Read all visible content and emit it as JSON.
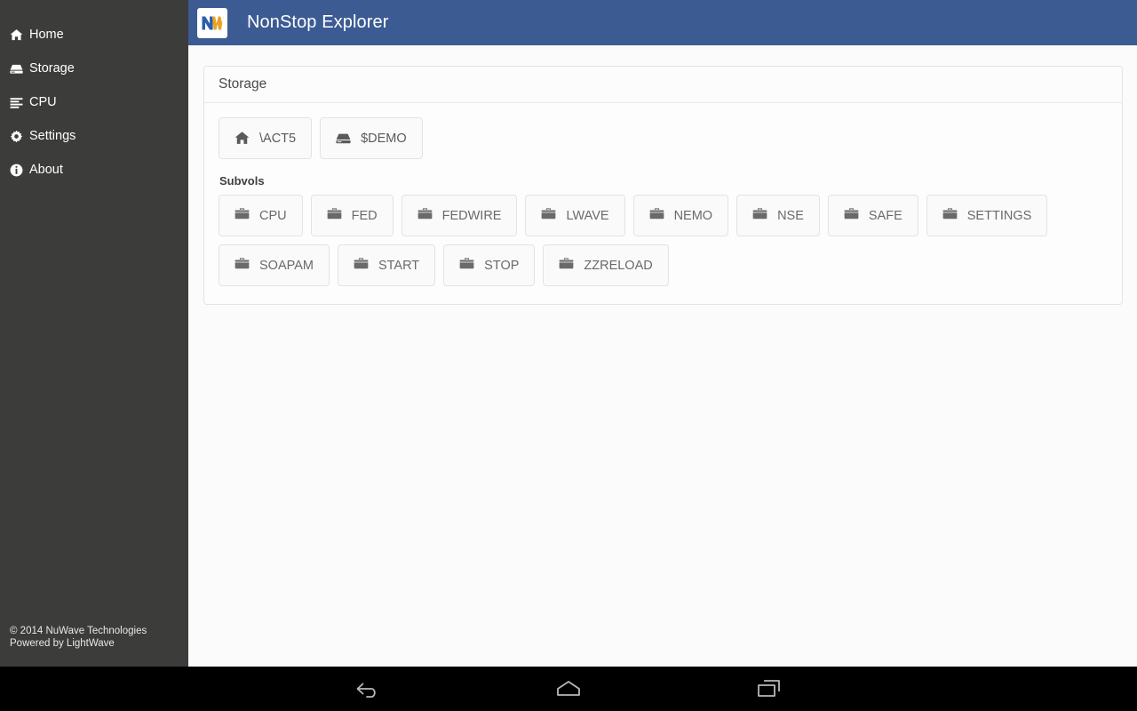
{
  "app": {
    "title": "NonStop Explorer",
    "logo_icon": "nuwave-nw-logo",
    "header_color": "#3b5b92",
    "sidebar_color": "#3c3c3b"
  },
  "sidebar": {
    "items": [
      {
        "label": "Home",
        "icon": "home-icon"
      },
      {
        "label": "Storage",
        "icon": "hard-drive-icon"
      },
      {
        "label": "CPU",
        "icon": "align-left-icon"
      },
      {
        "label": "Settings",
        "icon": "gear-icon"
      },
      {
        "label": "About",
        "icon": "info-circle-icon"
      }
    ],
    "footer": {
      "copyright": "© 2014 NuWave Technologies",
      "powered_by": "Powered by LightWave"
    }
  },
  "panel": {
    "title": "Storage",
    "breadcrumb": [
      {
        "label": "\\ACT5",
        "icon": "home-icon"
      },
      {
        "label": "$DEMO",
        "icon": "hard-drive-icon"
      }
    ],
    "subvols_label": "Subvols",
    "subvols": [
      {
        "label": "CPU",
        "icon": "folder-icon"
      },
      {
        "label": "FED",
        "icon": "folder-icon"
      },
      {
        "label": "FEDWIRE",
        "icon": "folder-icon"
      },
      {
        "label": "LWAVE",
        "icon": "folder-icon"
      },
      {
        "label": "NEMO",
        "icon": "folder-icon"
      },
      {
        "label": "NSE",
        "icon": "folder-icon"
      },
      {
        "label": "SAFE",
        "icon": "folder-icon"
      },
      {
        "label": "SETTINGS",
        "icon": "folder-icon"
      },
      {
        "label": "SOAPAM",
        "icon": "folder-icon"
      },
      {
        "label": "START",
        "icon": "folder-icon"
      },
      {
        "label": "STOP",
        "icon": "folder-icon"
      },
      {
        "label": "ZZRELOAD",
        "icon": "folder-icon"
      }
    ]
  },
  "system_navbar": {
    "buttons": [
      {
        "name": "back-button",
        "icon": "back-arrow-icon"
      },
      {
        "name": "home-button",
        "icon": "home-pentagon-icon"
      },
      {
        "name": "recents-button",
        "icon": "recents-squares-icon"
      }
    ]
  }
}
